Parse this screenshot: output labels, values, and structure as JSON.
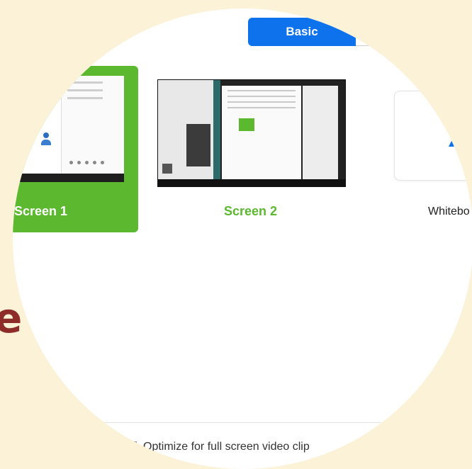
{
  "toolbar": {
    "basic_tab": "Basic"
  },
  "share_options": [
    {
      "label": "Screen 1",
      "selected": true
    },
    {
      "label": "Screen 2",
      "selected": false
    },
    {
      "label": "Whitebo",
      "selected": false
    }
  ],
  "footer": {
    "optimize_label": "Optimize for full screen video clip",
    "optimize_checked": false
  },
  "background_text": "e",
  "colors": {
    "accent_blue": "#0e72ed",
    "selected_green": "#5cb82f",
    "page_background": "#fbf2d8",
    "background_text": "#8e2c2a"
  }
}
